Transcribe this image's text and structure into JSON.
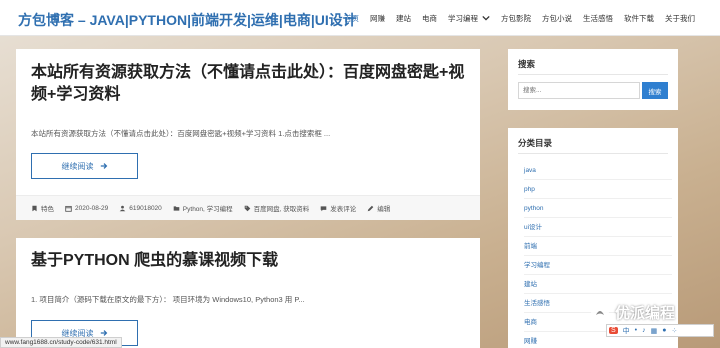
{
  "site": {
    "title": "方包博客 – JAVA|PYTHON|前端开发|运维|电商|UI设计"
  },
  "nav": {
    "items": [
      {
        "label": "首页"
      },
      {
        "label": "网赚"
      },
      {
        "label": "建站"
      },
      {
        "label": "电商"
      },
      {
        "label": "学习编程"
      },
      {
        "label": "方包影院"
      },
      {
        "label": "方包小说"
      },
      {
        "label": "生活感悟"
      },
      {
        "label": "软件下载"
      },
      {
        "label": "关于我们"
      }
    ]
  },
  "posts": [
    {
      "title": "本站所有资源获取方法（不懂请点击此处）：百度网盘密匙+视频+学习资料",
      "excerpt": "本站所有资源获取方法（不懂请点击此处）：百度网盘密匙+视频+学习资料   1.点击搜索框 ...",
      "read_more": "继续阅读",
      "meta": {
        "sticky": "特色",
        "date": "2020-08-29",
        "author": "619018020",
        "categories": "Python, 学习编程",
        "tags": "百度网盘, 获取资料",
        "comments": "发表评论",
        "edit": "编辑"
      }
    },
    {
      "title": "基于PYTHON 爬虫的慕课视频下载",
      "excerpt": "1. 项目简介（源码下载在原文的最下方）：   项目环境为 Windows10, Python3 用 P...",
      "read_more": "继续阅读"
    }
  ],
  "sidebar": {
    "search": {
      "title": "搜索",
      "placeholder": "搜索...",
      "button": "搜索"
    },
    "categories": {
      "title": "分类目录",
      "items": [
        "java",
        "php",
        "python",
        "ui设计",
        "前端",
        "学习编程",
        "建站",
        "生活感悟",
        "电商",
        "网赚"
      ]
    }
  },
  "status_bar": {
    "url": "www.fang1688.cn/study-code/631.html"
  },
  "watermark": {
    "text": "优派编程"
  },
  "ime_toolbar": {
    "s": "S",
    "mode": "中"
  },
  "colors": {
    "accent": "#2f6fb0",
    "button": "#2f7fd0"
  }
}
